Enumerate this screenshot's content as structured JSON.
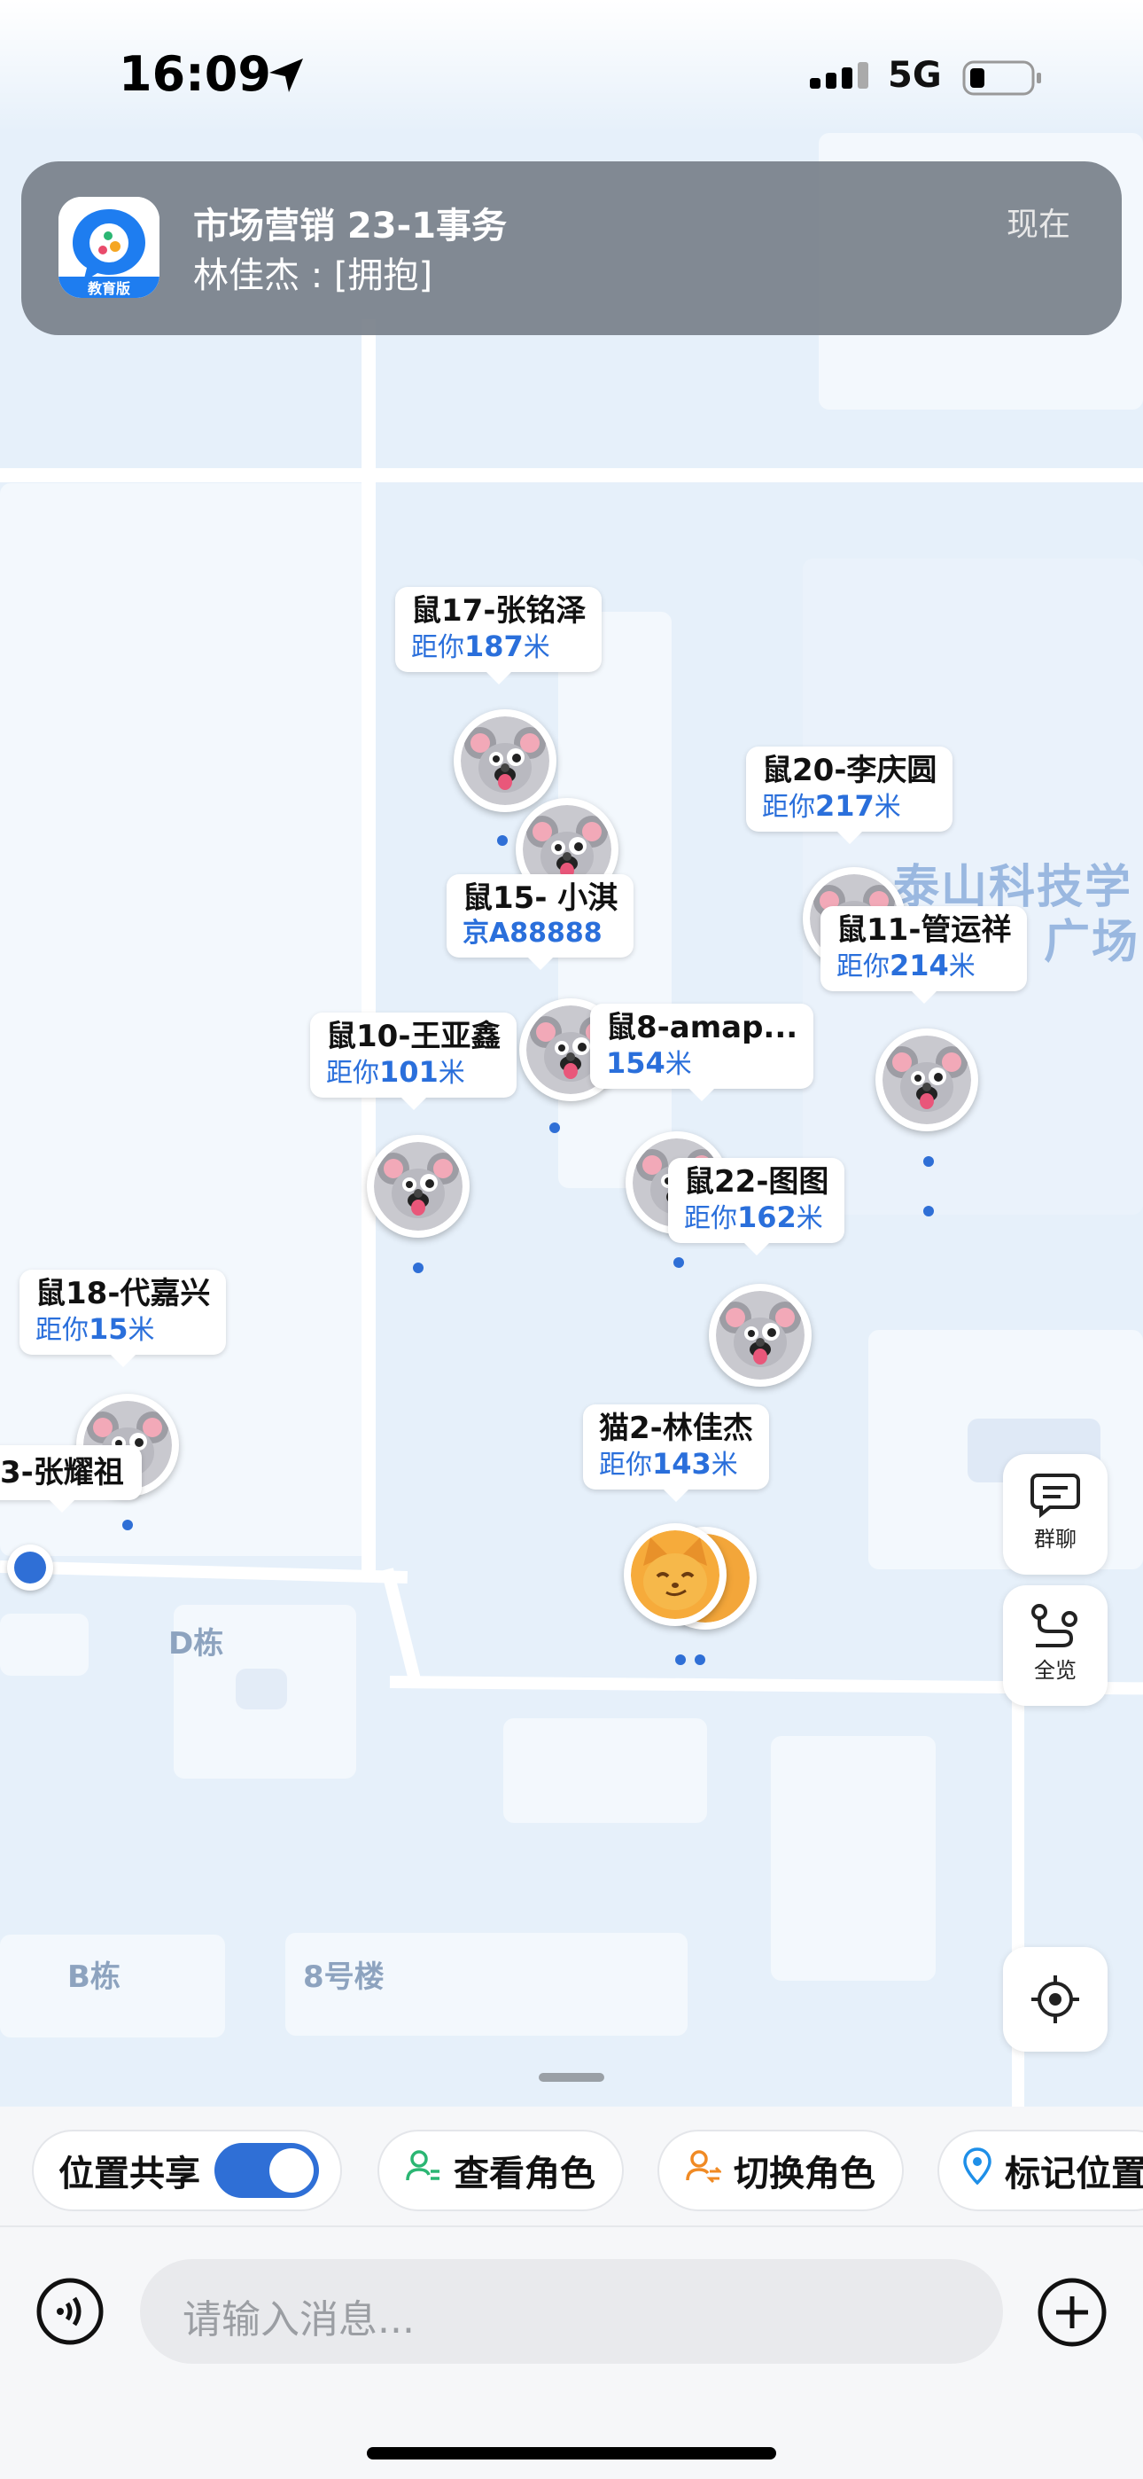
{
  "status_bar": {
    "time": "16:09",
    "network": "5G"
  },
  "notification": {
    "app_badge": "教育版",
    "title": "市场营销 23-1事务",
    "body": "林佳杰 : [拥抱]",
    "time": "现在"
  },
  "map": {
    "labels": {
      "building_d": "D栋",
      "building_b": "B栋",
      "building_8": "8号楼",
      "poi_line1": "泰山科技学",
      "poi_line2": "广场"
    },
    "markers": [
      {
        "name": "鼠17-张铭泽",
        "dist_prefix": "距你",
        "dist": "187",
        "dist_unit": "米",
        "avatar": "mouse"
      },
      {
        "name": "鼠20-李庆圆",
        "dist_prefix": "距你",
        "dist": "217",
        "dist_unit": "米",
        "avatar": "mouse"
      },
      {
        "name": "鼠15-  小淇",
        "plate": "京A88888",
        "avatar": "mouse"
      },
      {
        "name": "鼠11-管运祥",
        "dist_prefix": "距你",
        "dist": "214",
        "dist_unit": "米",
        "avatar": "mouse"
      },
      {
        "name": "鼠10-王亚鑫",
        "dist_prefix": "距你",
        "dist": "101",
        "dist_unit": "米",
        "avatar": "mouse"
      },
      {
        "name": "鼠8-amap...",
        "dist": "154",
        "dist_unit": "米",
        "avatar": "mouse"
      },
      {
        "name": "鼠22-图图",
        "dist_prefix": "距你",
        "dist": "162",
        "dist_unit": "米",
        "avatar": "mouse"
      },
      {
        "name": "鼠18-代嘉兴",
        "dist_prefix": "距你",
        "dist": "15",
        "dist_unit": "米",
        "avatar": "mouse"
      },
      {
        "name": "3-张耀祖",
        "avatar": "mouse"
      },
      {
        "name": "猫2-林佳杰",
        "dist_prefix": "距你",
        "dist": "143",
        "dist_unit": "米",
        "avatar": "cat"
      }
    ]
  },
  "controls": {
    "group_chat": "群聊",
    "overview": "全览"
  },
  "toolbar": {
    "location_share": "位置共享",
    "location_share_on": true,
    "view_roles": "查看角色",
    "switch_role": "切换角色",
    "mark_location": "标记位置"
  },
  "composer": {
    "placeholder": "请输入消息..."
  },
  "colors": {
    "accent": "#2f6fd6",
    "distance": "#2a6fdb",
    "role_green": "#2bb673",
    "role_orange": "#f08a24"
  }
}
